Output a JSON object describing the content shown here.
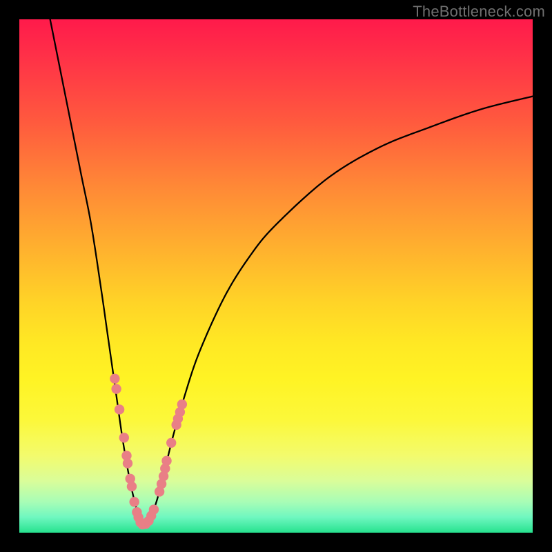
{
  "watermark": "TheBottleneck.com",
  "colors": {
    "curve_stroke": "#000000",
    "marker_fill": "#e97f86",
    "marker_stroke": "#d46a72",
    "frame": "#000000"
  },
  "chart_data": {
    "type": "line",
    "title": "",
    "xlabel": "",
    "ylabel": "",
    "xlim": [
      0,
      100
    ],
    "ylim": [
      0,
      100
    ],
    "grid": false,
    "legend": false,
    "series": [
      {
        "name": "left-curve",
        "x": [
          6,
          8,
          10,
          12,
          14,
          16,
          17,
          18,
          19,
          20,
          21,
          22,
          23,
          23.8
        ],
        "y": [
          100,
          90,
          80,
          70,
          60,
          47,
          40,
          33,
          26,
          19,
          13,
          8,
          4,
          1.5
        ]
      },
      {
        "name": "right-curve",
        "x": [
          23.8,
          25,
          26,
          27,
          28,
          29,
          30,
          32,
          35,
          40,
          45,
          50,
          60,
          70,
          80,
          90,
          100
        ],
        "y": [
          1.5,
          2,
          4,
          7,
          11,
          15,
          19,
          26,
          35,
          46,
          54,
          60,
          69,
          75,
          79,
          82.5,
          85
        ]
      }
    ],
    "markers": {
      "name": "highlight-points",
      "xy": [
        [
          18.6,
          30
        ],
        [
          18.9,
          28
        ],
        [
          19.5,
          24
        ],
        [
          20.4,
          18.5
        ],
        [
          20.9,
          15
        ],
        [
          21.1,
          13.5
        ],
        [
          21.6,
          10.5
        ],
        [
          21.9,
          9
        ],
        [
          22.4,
          6
        ],
        [
          22.9,
          4
        ],
        [
          23.2,
          3
        ],
        [
          23.6,
          2
        ],
        [
          24.0,
          1.6
        ],
        [
          24.6,
          1.7
        ],
        [
          25.2,
          2.3
        ],
        [
          25.7,
          3.3
        ],
        [
          26.2,
          4.5
        ],
        [
          27.3,
          8
        ],
        [
          27.7,
          9.5
        ],
        [
          28.1,
          11
        ],
        [
          28.4,
          12.5
        ],
        [
          28.7,
          14
        ],
        [
          29.6,
          17.5
        ],
        [
          30.6,
          21
        ],
        [
          30.9,
          22.2
        ],
        [
          31.3,
          23.5
        ],
        [
          31.7,
          25
        ]
      ]
    }
  }
}
